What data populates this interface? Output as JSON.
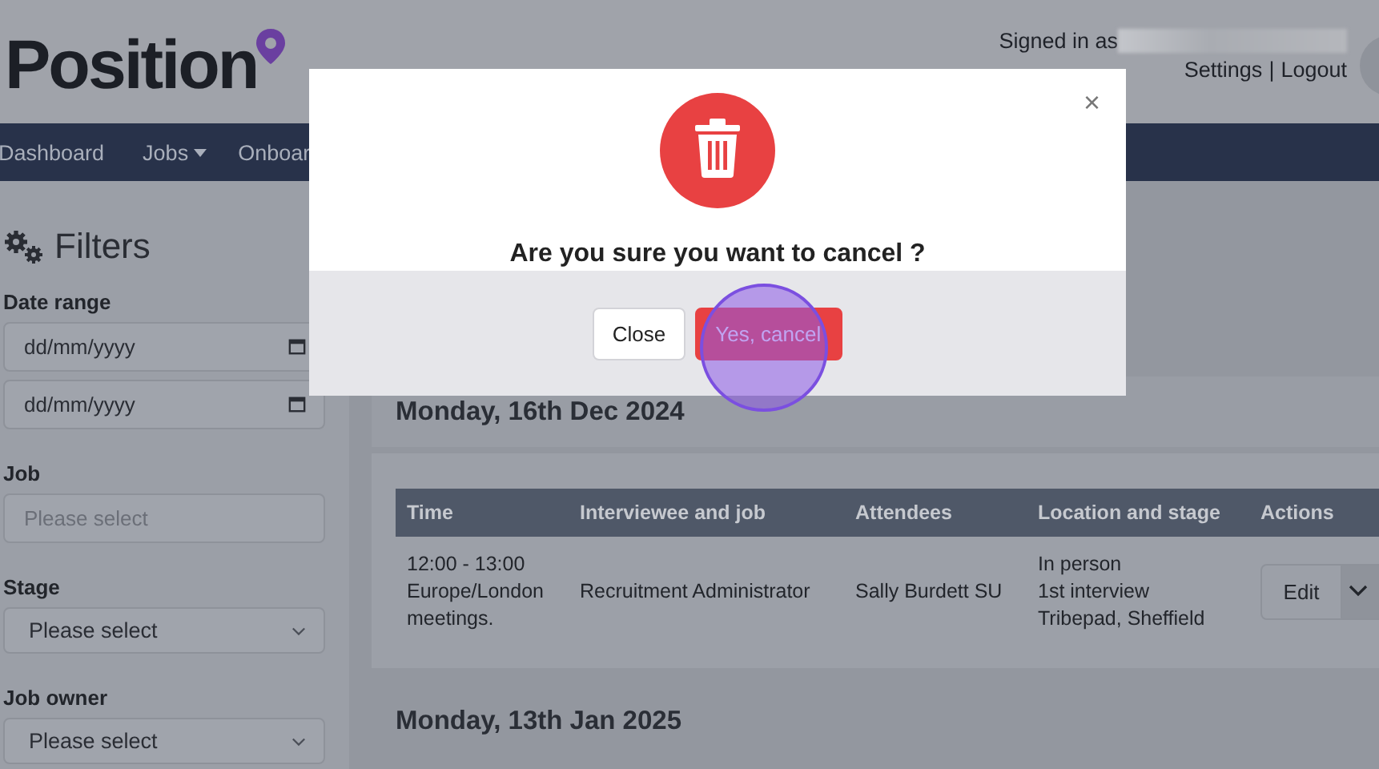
{
  "header": {
    "logo": "Position",
    "signed_in_label": "Signed in as",
    "links": [
      "Settings",
      "Logout"
    ],
    "separator": "|"
  },
  "nav": {
    "items": [
      {
        "label": "Dashboard",
        "dropdown": false
      },
      {
        "label": "Jobs",
        "dropdown": true
      },
      {
        "label": "Onboar",
        "dropdown": false
      }
    ]
  },
  "filters": {
    "title": "Filters",
    "groups": [
      {
        "label": "Date range",
        "fields": [
          {
            "kind": "date",
            "value": "dd/mm/yyyy"
          },
          {
            "kind": "date",
            "value": "dd/mm/yyyy"
          }
        ]
      },
      {
        "label": "Job",
        "fields": [
          {
            "kind": "text",
            "placeholder": "Please select"
          }
        ]
      },
      {
        "label": "Stage",
        "fields": [
          {
            "kind": "select",
            "value": "Please select"
          }
        ]
      },
      {
        "label": "Job owner",
        "fields": [
          {
            "kind": "select",
            "value": "Please select"
          }
        ]
      }
    ]
  },
  "days": [
    {
      "title": "Monday, 16th Dec 2024",
      "table": {
        "columns": [
          "Time",
          "Interviewee and job",
          "Attendees",
          "Location and stage",
          "Actions"
        ],
        "rows": [
          {
            "time": [
              "12:00 - 13:00",
              "Europe/London",
              "meetings."
            ],
            "interviewee_and_job": "Recruitment Administrator",
            "attendees": "Sally Burdett SU",
            "location_and_stage": [
              "In person",
              "1st interview",
              "Tribepad, Sheffield"
            ],
            "action": "Edit"
          }
        ]
      }
    },
    {
      "title": "Monday, 13th Jan 2025"
    }
  ],
  "modal": {
    "close_symbol": "×",
    "question": "Are you sure you want to cancel ?",
    "buttons": [
      {
        "label": "Close",
        "kind": "secondary"
      },
      {
        "label": "Yes, cancel",
        "kind": "danger"
      }
    ]
  }
}
